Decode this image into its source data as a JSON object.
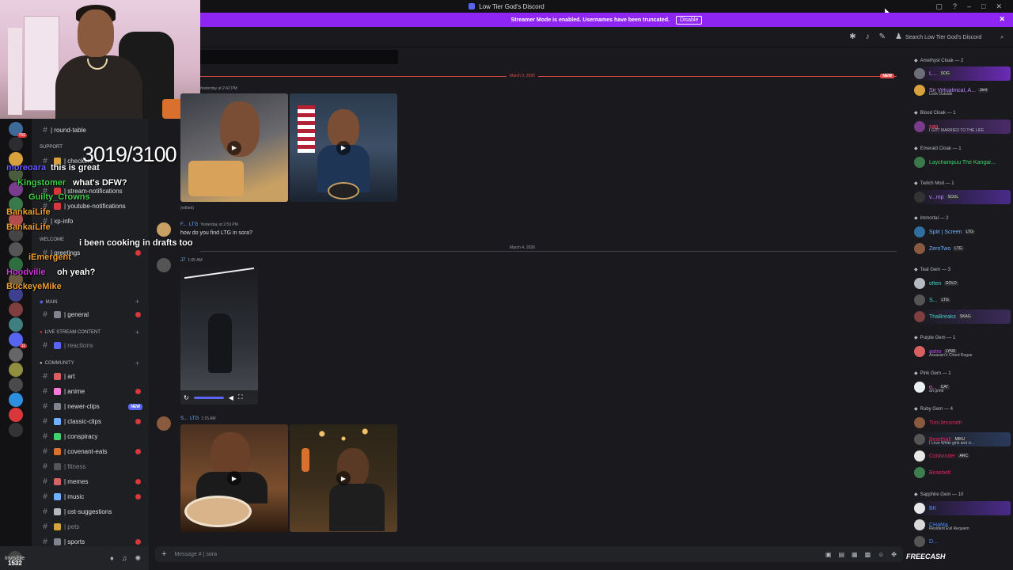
{
  "window": {
    "title": "Low Tier God's Discord"
  },
  "banner": {
    "text": "Streamer Mode is enabled. Usernames have been truncated.",
    "button": "Disable"
  },
  "header": {
    "search_placeholder": "Search Low Tier God's Discord"
  },
  "overlay": {
    "counter": "3019/3100",
    "chat": [
      {
        "user": "moreoara",
        "text": "this is great",
        "color": "#6b5cff"
      },
      {
        "user": "Kingstomer",
        "text": "what's DFW?",
        "color": "#3fd14a"
      },
      {
        "user": "Guilty_Crowns",
        "text": "",
        "color": "#3fd14a"
      },
      {
        "user": "BankaiLife",
        "text": "",
        "color": "#f0a030"
      },
      {
        "user": "BankaiLife",
        "text": "i been cooking in drafts too",
        "color": "#f0a030"
      },
      {
        "user": "iEmergent",
        "text": "",
        "color": "#f0a030"
      },
      {
        "user": "Hoodville",
        "text": "oh yeah?",
        "color": "#c93ad8"
      },
      {
        "user": "BuckeyeMike",
        "text": "",
        "color": "#f0a030"
      }
    ]
  },
  "channels": {
    "items": [
      {
        "label": "| round-table",
        "unread": false,
        "muted": false
      },
      {
        "label": "SUPPORT",
        "type": "category"
      },
      {
        "label": "| checkers",
        "unread": false,
        "muted": false
      },
      {
        "label": "| stream-notifications",
        "unread": false,
        "muted": false
      },
      {
        "label": "| youtube-notifications",
        "unread": false,
        "muted": false
      },
      {
        "label": "| xp-info",
        "unread": false,
        "muted": false
      },
      {
        "label": "WELCOME",
        "type": "category"
      },
      {
        "label": "| greetings",
        "unread": false,
        "muted": false
      },
      {
        "label": "| rules",
        "unread": false,
        "muted": false
      },
      {
        "label": "MAIN",
        "type": "category"
      },
      {
        "label": "| general",
        "unread": true,
        "muted": false
      },
      {
        "label": "LIVE STREAM CONTENT",
        "type": "category"
      },
      {
        "label": "| reactions",
        "unread": false,
        "muted": true
      },
      {
        "label": "COMMUNITY",
        "type": "category"
      },
      {
        "label": "| art",
        "unread": false,
        "muted": false
      },
      {
        "label": "| anime",
        "unread": true,
        "muted": false
      },
      {
        "label": "| newer-clips",
        "unread": false,
        "muted": false,
        "new": "NEW"
      },
      {
        "label": "| classic-clips",
        "unread": true,
        "muted": false
      },
      {
        "label": "| conspiracy",
        "unread": false,
        "muted": false
      },
      {
        "label": "| covenant-eats",
        "unread": true,
        "muted": false
      },
      {
        "label": "| fitness",
        "unread": false,
        "muted": true
      },
      {
        "label": "| memes",
        "unread": true,
        "muted": false
      },
      {
        "label": "| music",
        "unread": true,
        "muted": false
      },
      {
        "label": "| ost-suggestions",
        "unread": false,
        "muted": false
      },
      {
        "label": "| pets",
        "unread": false,
        "muted": true
      },
      {
        "label": "| sports",
        "unread": true,
        "muted": false
      }
    ]
  },
  "user_panel": {
    "name": "Invisible",
    "viewers": "1532"
  },
  "messages": {
    "divider1": "March 3, 2026",
    "new_tag": "NEW",
    "m1": {
      "time": "Yesterday at 2:42 PM",
      "edited": "(edited)"
    },
    "m2": {
      "user": "F...",
      "tag": "LTG",
      "time": "Yesterday at 2:59 PM",
      "text": "how do you find LTG in sora?"
    },
    "divider2": "March 4, 2026",
    "m3": {
      "user": "J7",
      "time": "1:05 AM"
    },
    "m4": {
      "user": "S...",
      "tag": "LTG",
      "time": "1:15 AM"
    }
  },
  "composer": {
    "placeholder": "Message #  | sora"
  },
  "members": {
    "groups": [
      {
        "role": "Amethyst Cloak — 2",
        "items": [
          {
            "name": "L...",
            "tag": "SOG",
            "color": "#c08bff"
          },
          {
            "name": "Sir Virtualmcal, A...",
            "tag": "Jent",
            "sub": "Look Outside",
            "color": "#c08bff"
          }
        ]
      },
      {
        "role": "Blood Cloak — 1",
        "items": [
          {
            "name": "sag",
            "sub": "I GOT MARRIED TO THE LIFE",
            "color": "#ff4d6d"
          }
        ]
      },
      {
        "role": "Emerald Cloak — 1",
        "items": [
          {
            "name": "Laychampuu The Kangar...",
            "color": "#3fd16a"
          }
        ]
      },
      {
        "role": "Twitch Mod — 1",
        "items": [
          {
            "name": "v...mp",
            "tag": "SOUL",
            "color": "#c08bff"
          }
        ]
      },
      {
        "role": "Immortal — 2",
        "items": [
          {
            "name": "Split | Screen",
            "tag": "LTG",
            "color": "#6fb1ff"
          },
          {
            "name": "ZeroTwo",
            "tag": "LTG",
            "color": "#6fb1ff"
          }
        ]
      },
      {
        "role": "Teal Gem — 3",
        "items": [
          {
            "name": "often",
            "tag": "GOLD",
            "color": "#3fd1c3"
          },
          {
            "name": "S...",
            "tag": "LTG",
            "color": "#3fd1c3"
          },
          {
            "name": "ThaBreaks",
            "tag": "SKAG",
            "color": "#3fd1c3"
          }
        ]
      },
      {
        "role": "Purple Gem — 1",
        "items": [
          {
            "name": "astro",
            "tag": "LYNX",
            "sub": "Assassin's Creed Rogue",
            "color": "#c04bff"
          }
        ]
      },
      {
        "role": "Pink Gem — 1",
        "items": [
          {
            "name": "o...",
            "tag": "CAT",
            "sub": "art grind",
            "color": "#ff7ad9"
          }
        ]
      },
      {
        "role": "Ruby Gem — 4",
        "items": [
          {
            "name": "Tim/Jensmith",
            "color": "#e0245e"
          },
          {
            "name": "Bearthall",
            "tag": "MIKU",
            "sub": "I Love White girls and Li...",
            "color": "#e0245e"
          },
          {
            "name": "Coldvinder",
            "tag": "ARC",
            "color": "#e0245e"
          },
          {
            "name": "Bosebelt",
            "color": "#e0245e"
          }
        ]
      },
      {
        "role": "Sapphire Gem — 10",
        "items": [
          {
            "name": "BK",
            "color": "#4a8cff"
          },
          {
            "name": "CHaMa",
            "sub": "Resident Evil Requiem",
            "color": "#4a8cff"
          },
          {
            "name": "D...",
            "color": "#4a8cff"
          }
        ]
      }
    ]
  },
  "footer": {
    "brand": "FREECASH"
  },
  "colors": {
    "accent": "#5865f2",
    "banner": "#8f25f2",
    "unread": "#da373c",
    "new_divider": "#e34b4b"
  }
}
